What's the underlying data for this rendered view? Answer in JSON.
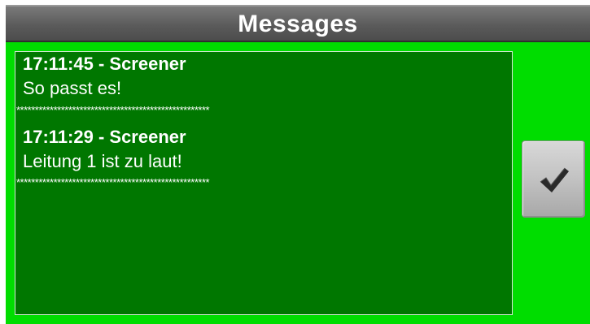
{
  "window": {
    "title": "Messages"
  },
  "messages": [
    {
      "header": "17:11:45 - Screener",
      "body": "So passt es!",
      "separator": "****************************************************"
    },
    {
      "header": "17:11:29 - Screener",
      "body": "Leitung 1 ist zu laut!",
      "separator": "****************************************************"
    }
  ],
  "confirm_button": {
    "icon": "checkmark-icon"
  },
  "colors": {
    "background": "#00dd00",
    "panel": "#007700",
    "titlebar": "#5b5b5b",
    "text": "#ffffff"
  }
}
